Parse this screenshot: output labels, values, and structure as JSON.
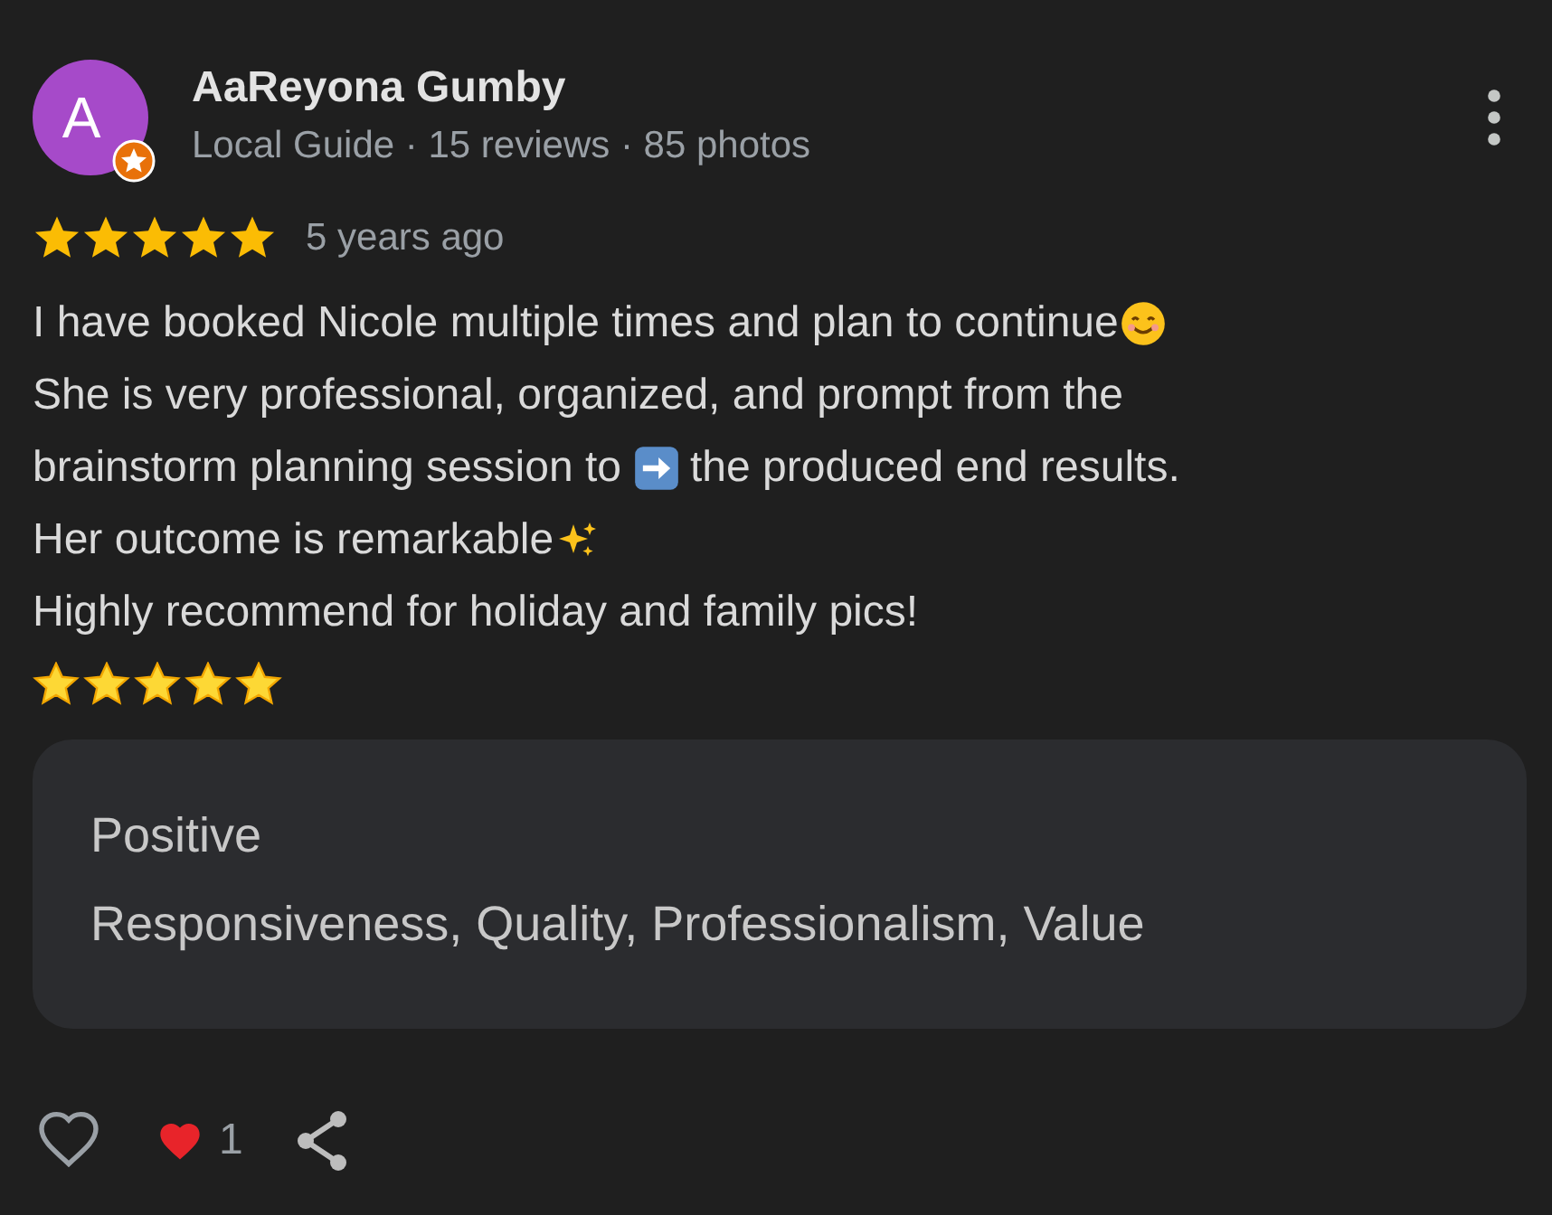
{
  "reviewer": {
    "initial": "A",
    "name": "AaReyona Gumby",
    "meta": "Local Guide · 15 reviews · 85 photos",
    "local_guide": true
  },
  "rating": {
    "stars": 5,
    "time": "5 years ago"
  },
  "body": [
    [
      {
        "kind": "text",
        "text": "I have booked Nicole multiple times and plan to continue"
      },
      {
        "kind": "smile"
      }
    ],
    [
      {
        "kind": "text",
        "text": "She is very professional, organized, and prompt from the"
      }
    ],
    [
      {
        "kind": "text",
        "text": "brainstorm planning session to"
      },
      {
        "kind": "arrow"
      },
      {
        "kind": "text",
        "text": "the produced end results."
      }
    ],
    [
      {
        "kind": "text",
        "text": "Her outcome is remarkable"
      },
      {
        "kind": "sparkles"
      }
    ],
    [
      {
        "kind": "text",
        "text": "Highly recommend for holiday and family pics!"
      }
    ],
    [
      {
        "kind": "stars"
      }
    ]
  ],
  "summary": {
    "heading": "Positive",
    "text": "Responsiveness, Quality, Professionalism, Value"
  },
  "reactions": {
    "count": "1"
  }
}
